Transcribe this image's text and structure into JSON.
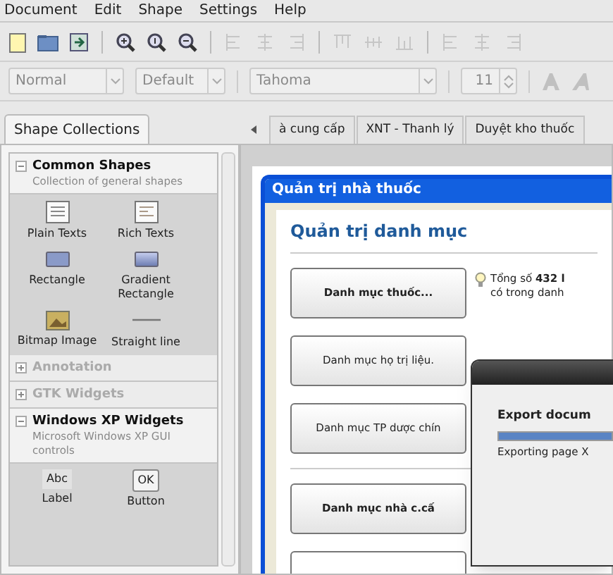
{
  "menu": [
    "Document",
    "Edit",
    "Shape",
    "Settings",
    "Help"
  ],
  "toolbar": [
    {
      "kind": "new",
      "disabled": false
    },
    {
      "kind": "open",
      "disabled": false
    },
    {
      "kind": "export",
      "disabled": false
    },
    {
      "kind": "separator"
    },
    {
      "kind": "zoom-in",
      "disabled": false
    },
    {
      "kind": "zoom-reset",
      "disabled": false
    },
    {
      "kind": "zoom-out",
      "disabled": false
    },
    {
      "kind": "separator"
    },
    {
      "kind": "align-left",
      "disabled": true
    },
    {
      "kind": "align-center",
      "disabled": true
    },
    {
      "kind": "align-right",
      "disabled": true
    },
    {
      "kind": "separator"
    },
    {
      "kind": "align-top",
      "disabled": true
    },
    {
      "kind": "align-middle",
      "disabled": true
    },
    {
      "kind": "align-bottom",
      "disabled": true
    },
    {
      "kind": "separator"
    },
    {
      "kind": "align-left",
      "disabled": true
    },
    {
      "kind": "align-center",
      "disabled": true
    },
    {
      "kind": "align-right",
      "disabled": true
    }
  ],
  "format_bar": [
    {
      "kind": "combo",
      "value": "Normal",
      "disabled": true
    },
    {
      "kind": "combo",
      "value": "Default",
      "disabled": true
    },
    {
      "kind": "separator"
    },
    {
      "kind": "combo",
      "value": "Tahoma",
      "disabled": true
    },
    {
      "kind": "separator"
    },
    {
      "kind": "spin",
      "value": "11",
      "disabled": true
    },
    {
      "kind": "separator"
    },
    {
      "kind": "bold",
      "disabled": true
    },
    {
      "kind": "italic",
      "disabled": true
    }
  ],
  "sidebar": {
    "tab": {
      "label": "Shape Collections",
      "selected": true
    },
    "collections": [
      {
        "title": "Common Shapes",
        "subtitle": "Collection of general shapes",
        "expanded": true,
        "shapes": [
          {
            "label": "Plain Texts",
            "kind": "text"
          },
          {
            "label": "Rich Texts",
            "kind": "richtext"
          },
          {
            "label": "Rectangle",
            "kind": "rect"
          },
          {
            "label": "Gradient Rectangle",
            "kind": "gradient"
          },
          {
            "label": "Bitmap Image",
            "kind": "bitmap"
          },
          {
            "label": "Straight line",
            "kind": "line"
          }
        ]
      },
      {
        "title": "Annotation",
        "expanded": false
      },
      {
        "title": "GTK Widgets",
        "expanded": false
      },
      {
        "title": "Windows XP Widgets",
        "subtitle": "Microsoft Windows XP GUI controls",
        "expanded": true,
        "shapes": [
          {
            "label": "Label",
            "kind": "label",
            "sample": "Abc"
          },
          {
            "label": "Button",
            "kind": "button",
            "sample": "OK"
          }
        ]
      }
    ]
  },
  "document_tabs": [
    {
      "label": "à cung cấp",
      "selected": false
    },
    {
      "label": "XNT - Thanh lý",
      "selected": false
    },
    {
      "label": "Duyệt kho thuốc",
      "selected": false
    }
  ],
  "mockup": {
    "window_title": "Quản trị nhà thuốc",
    "heading": "Quản trị danh mục",
    "button_groups": [
      [
        {
          "label": "Danh mục thuốc...",
          "bold": true
        },
        {
          "label": "Danh mục họ trị liệu.",
          "bold": false
        },
        {
          "label": "Danh mục TP dược chín",
          "bold": false
        }
      ],
      [
        {
          "label": "Danh mục nhà c.cấ",
          "bold": true
        }
      ]
    ],
    "hint": [
      "Tổng số **432 l**",
      "có trong danh"
    ]
  },
  "export_dialog": {
    "heading": "Export docum",
    "progress": {
      "level": 1
    },
    "status": "Exporting page X"
  }
}
